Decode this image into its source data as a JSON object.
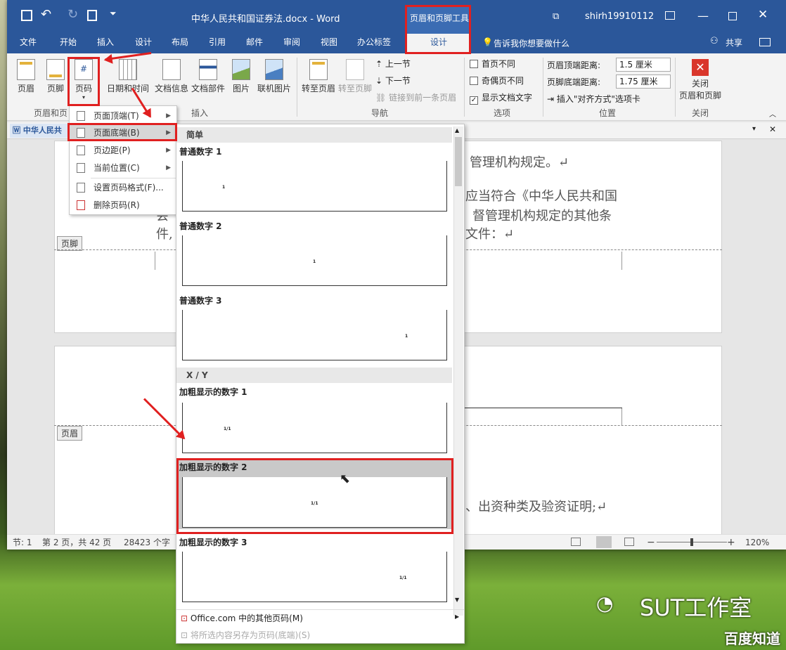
{
  "title": {
    "doc_name": "中华人民共和国证券法.docx - Word",
    "context_tool": "页眉和页脚工具",
    "user": "shirh19910112"
  },
  "tabs": [
    "文件",
    "开始",
    "插入",
    "设计",
    "布局",
    "引用",
    "邮件",
    "审阅",
    "视图",
    "办公标签"
  ],
  "context_tab": "设计",
  "tell_me": "告诉我你想要做什么",
  "share": "共享",
  "ribbon": {
    "header_footer_group": {
      "header": "页眉",
      "footer": "页脚",
      "page_number": "页码",
      "label": "页眉和页"
    },
    "insert_group": {
      "datetime": "日期和时间",
      "docinfo": "文档信息",
      "docparts": "文档部件",
      "picture": "图片",
      "online_picture": "联机图片",
      "label": "插入"
    },
    "nav_group": {
      "goto_header": "转至页眉",
      "goto_footer": "转至页脚",
      "prev": "上一节",
      "next": "下一节",
      "link_prev": "链接到前一条页眉",
      "label": "导航"
    },
    "options_group": {
      "first_page": "首页不同",
      "odd_even": "奇偶页不同",
      "show_text": "显示文档文字",
      "label": "选项"
    },
    "position_group": {
      "header_dist_label": "页眉顶端距离:",
      "header_dist": "1.5 厘米",
      "footer_dist_label": "页脚底端距离:",
      "footer_dist": "1.75 厘米",
      "align_tab": "插入\"对齐方式\"选项卡",
      "label": "位置"
    },
    "close_group": {
      "close_line1": "关闭",
      "close_line2": "页眉和页脚",
      "label": "关闭"
    }
  },
  "doc_tab": "中华人民共",
  "menu": [
    {
      "label": "页面顶端(T)",
      "arrow": true
    },
    {
      "label": "页面底端(B)",
      "arrow": true
    },
    {
      "label": "页边距(P)",
      "arrow": true
    },
    {
      "label": "当前位置(C)",
      "arrow": true
    },
    {
      "label": "设置页码格式(F)...",
      "arrow": false
    },
    {
      "label": "删除页码(R)",
      "arrow": false
    }
  ],
  "gallery": {
    "section_simple": "简单",
    "section_xy": "X / Y",
    "items": [
      {
        "name": "普通数字 1",
        "sample": "1"
      },
      {
        "name": "普通数字 2",
        "sample": "1"
      },
      {
        "name": "普通数字 3",
        "sample": "1"
      },
      {
        "name": "加粗显示的数字 1",
        "sample": "1/1"
      },
      {
        "name": "加粗显示的数字 2",
        "sample": "1/1"
      },
      {
        "name": "加粗显示的数字 3",
        "sample": "1/1"
      }
    ],
    "more": "Office.com 中的其他页码(M)",
    "save_selection": "将所选内容另存为页码(底端)(S)"
  },
  "document": {
    "line1": "管理机构规定。↵",
    "line2": "应当符合《中华人民共和国",
    "line3": "督管理机构规定的其他条",
    "line4": "文件：↵",
    "line2_left": "会",
    "line3_left": "件,",
    "line5": "、出资种类及验资证明;↵",
    "footer_label": "页脚",
    "header_label": "页眉"
  },
  "status": {
    "section": "节: 1",
    "page": "第 2 页，共 42 页",
    "words": "28423 个字",
    "zoom": "120%"
  },
  "watermark": {
    "brand": "SUT工作室",
    "site": "百度知道"
  }
}
